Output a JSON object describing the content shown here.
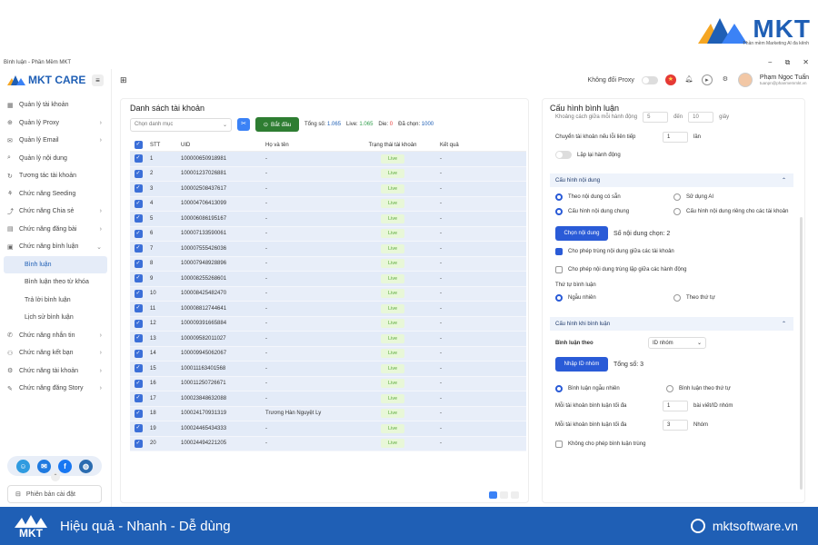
{
  "brand": {
    "name": "MKT",
    "tagline": "Phần mềm Marketing AI đa kênh"
  },
  "window": {
    "title": "Bình luận - Phần Mềm MKT",
    "min": "−",
    "max": "⧉",
    "close": "✕"
  },
  "sidebar": {
    "logo": "MKT CARE",
    "items": [
      {
        "label": "Quản lý tài khoản",
        "icon": "grid-icon",
        "chev": ""
      },
      {
        "label": "Quản lý Proxy",
        "icon": "proxy-icon",
        "chev": "›"
      },
      {
        "label": "Quản lý Email",
        "icon": "mail-icon",
        "chev": "›"
      },
      {
        "label": "Quản lý nội dung",
        "icon": "content-icon",
        "chev": ""
      },
      {
        "label": "Tương tác tài khoản",
        "icon": "interact-icon",
        "chev": ""
      },
      {
        "label": "Chức năng Seeding",
        "icon": "seeding-icon",
        "chev": ""
      },
      {
        "label": "Chức năng Chia sẻ",
        "icon": "share-icon",
        "chev": "›"
      },
      {
        "label": "Chức năng đăng bài",
        "icon": "post-icon",
        "chev": "›"
      },
      {
        "label": "Chức năng bình luận",
        "icon": "comment-icon",
        "chev": "⌄"
      }
    ],
    "sub_items": [
      "Bình luận",
      "Bình luận theo từ khóa",
      "Trả lời bình luận",
      "Lịch sử bình luận"
    ],
    "items2": [
      {
        "label": "Chức năng nhắn tin",
        "icon": "message-icon",
        "chev": "›"
      },
      {
        "label": "Chức năng kết bạn",
        "icon": "friend-icon",
        "chev": "›"
      },
      {
        "label": "Chức năng tài khoản",
        "icon": "account-icon",
        "chev": "›"
      },
      {
        "label": "Chức năng đăng Story",
        "icon": "story-icon",
        "chev": "›"
      }
    ],
    "version": "Phiên bản cài đặt"
  },
  "header": {
    "proxy_label": "Không đổi Proxy",
    "user_name": "Phạm Ngọc Tuấn",
    "user_email": "tuanpn@phanmemmkt.vn"
  },
  "accounts": {
    "title": "Danh sách tài khoản",
    "category_placeholder": "Chọn danh mục",
    "start_label": "Bắt đầu",
    "total_label": "Tổng số:",
    "total": "1.065",
    "live_label": "Live:",
    "live": "1.065",
    "die_label": "Die:",
    "die": "0",
    "selected_label": "Đã chọn:",
    "selected": "1000",
    "columns": [
      "STT",
      "UID",
      "Họ và tên",
      "Trạng thái tài khoản",
      "Kết quả"
    ],
    "rows": [
      {
        "stt": "1",
        "uid": "100000650918981",
        "name": "-",
        "status": "Live",
        "result": "-"
      },
      {
        "stt": "2",
        "uid": "100001237026881",
        "name": "-",
        "status": "Live",
        "result": "-"
      },
      {
        "stt": "3",
        "uid": "100002508437617",
        "name": "-",
        "status": "Live",
        "result": "-"
      },
      {
        "stt": "4",
        "uid": "100004706413099",
        "name": "-",
        "status": "Live",
        "result": "-"
      },
      {
        "stt": "5",
        "uid": "100006086195167",
        "name": "-",
        "status": "Live",
        "result": "-"
      },
      {
        "stt": "6",
        "uid": "100007133590061",
        "name": "-",
        "status": "Live",
        "result": "-"
      },
      {
        "stt": "7",
        "uid": "100007555426036",
        "name": "-",
        "status": "Live",
        "result": "-"
      },
      {
        "stt": "8",
        "uid": "100007948928896",
        "name": "-",
        "status": "Live",
        "result": "-"
      },
      {
        "stt": "9",
        "uid": "100008255268601",
        "name": "-",
        "status": "Live",
        "result": "-"
      },
      {
        "stt": "10",
        "uid": "100008425482470",
        "name": "-",
        "status": "Live",
        "result": "-"
      },
      {
        "stt": "11",
        "uid": "100008812744641",
        "name": "-",
        "status": "Live",
        "result": "-"
      },
      {
        "stt": "12",
        "uid": "100009391665884",
        "name": "-",
        "status": "Live",
        "result": "-"
      },
      {
        "stt": "13",
        "uid": "100009582011027",
        "name": "-",
        "status": "Live",
        "result": "-"
      },
      {
        "stt": "14",
        "uid": "100009945062067",
        "name": "-",
        "status": "Live",
        "result": "-"
      },
      {
        "stt": "15",
        "uid": "100011163401568",
        "name": "-",
        "status": "Live",
        "result": "-"
      },
      {
        "stt": "16",
        "uid": "100011250726671",
        "name": "-",
        "status": "Live",
        "result": "-"
      },
      {
        "stt": "17",
        "uid": "100023848632088",
        "name": "-",
        "status": "Live",
        "result": "-"
      },
      {
        "stt": "18",
        "uid": "100024170931319",
        "name": "Trương Hàn Nguyệt Ly",
        "status": "Live",
        "result": "-"
      },
      {
        "stt": "19",
        "uid": "100024465434333",
        "name": "-",
        "status": "Live",
        "result": "-"
      },
      {
        "stt": "20",
        "uid": "100024494221205",
        "name": "-",
        "status": "Live",
        "result": "-"
      }
    ]
  },
  "config": {
    "title": "Cấu hình bình luận",
    "partial_top": "Khoảng cách giữa mỗi hành động",
    "partial_val1": "5",
    "partial_to": "đến",
    "partial_val2": "10",
    "partial_unit": "giây",
    "consec_fail_label": "Chuyển tài khoản nếu lỗi liên tiếp",
    "consec_fail_val": "1",
    "consec_fail_unit": "lần",
    "repeat_label": "Lặp lại hành động",
    "content_section": "Cấu hình nội dung",
    "opt_existing": "Theo nội dung có sẵn",
    "opt_ai": "Sử dụng AI",
    "opt_common": "Cấu hình nội dung chung",
    "opt_separate": "Cấu hình nội dung riêng cho các tài khoản",
    "choose_content_btn": "Chọn nội dung",
    "content_count": "Số nội dung chọn: 2",
    "allow_dup_accounts": "Cho phép trùng nội dung giữa các tài khoản",
    "allow_dup_actions": "Cho phép nội dung trùng lặp giữa các hành động",
    "order_label": "Thứ tự bình luận",
    "order_random": "Ngẫu nhiên",
    "order_sequential": "Theo thứ tự",
    "comment_section": "Cấu hình khi bình luận",
    "comment_by_label": "Bình luận theo",
    "comment_by_value": "ID nhóm",
    "import_btn": "Nhập ID nhóm",
    "import_total": "Tổng số: 3",
    "random_comment": "Bình luận ngẫu nhiên",
    "sequential_comment": "Bình luận theo thứ tự",
    "max_per_account_label": "Mỗi tài khoản bình luận tối đa",
    "max_per_account_val": "1",
    "max_per_account_unit": "bài viết/ID nhóm",
    "max_groups_label": "Mỗi tài khoản bình luận tối đa",
    "max_groups_val": "3",
    "max_groups_unit": "Nhóm",
    "no_dup_label": "Không cho phép bình luận trùng"
  },
  "banner": {
    "slogan": "Hiệu quả - Nhanh - Dễ dùng",
    "site": "mktsoftware.vn",
    "logo": "MKT"
  }
}
